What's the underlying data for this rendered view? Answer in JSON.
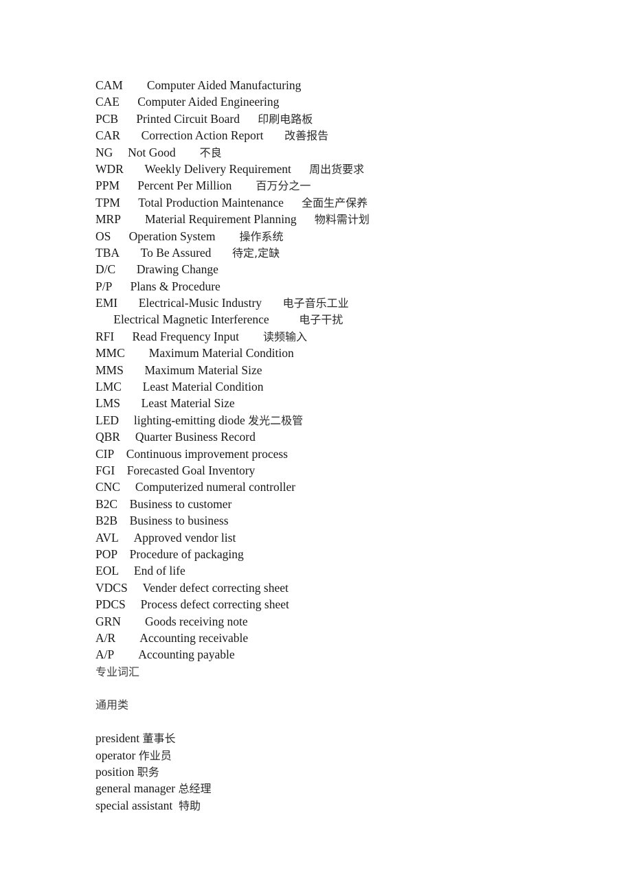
{
  "document": {
    "type": "bilingual-abbreviation-glossary",
    "page_background": "#ffffff",
    "text_color": "#181818",
    "abbreviation_entries": [
      {
        "abbr": "CAM",
        "gap1": "        ",
        "definition": "Computer Aided Manufacturing",
        "gap2": "",
        "chinese": ""
      },
      {
        "abbr": "CAE",
        "gap1": "      ",
        "definition": "Computer Aided Engineering",
        "gap2": "",
        "chinese": ""
      },
      {
        "abbr": "PCB",
        "gap1": "      ",
        "definition": "Printed Circuit Board",
        "gap2": "      ",
        "chinese": "印刷电路板"
      },
      {
        "abbr": "CAR",
        "gap1": "       ",
        "definition": "Correction Action Report",
        "gap2": "       ",
        "chinese": "改善报告"
      },
      {
        "abbr": "NG",
        "gap1": "     ",
        "definition": "Not Good",
        "gap2": "        ",
        "chinese": "不良"
      },
      {
        "abbr": "WDR",
        "gap1": "       ",
        "definition": "Weekly Delivery Requirement",
        "gap2": "      ",
        "chinese": "周出货要求"
      },
      {
        "abbr": "PPM",
        "gap1": "      ",
        "definition": "Percent Per Million",
        "gap2": "        ",
        "chinese": "百万分之一"
      },
      {
        "abbr": "TPM",
        "gap1": "      ",
        "definition": "Total Production Maintenance",
        "gap2": "      ",
        "chinese": "全面生产保养"
      },
      {
        "abbr": "MRP",
        "gap1": "        ",
        "definition": "Material Requirement Planning",
        "gap2": "      ",
        "chinese": "物料需计划"
      },
      {
        "abbr": "OS",
        "gap1": "      ",
        "definition": "Operation System",
        "gap2": "        ",
        "chinese": "操作系统"
      },
      {
        "abbr": "TBA",
        "gap1": "       ",
        "definition": "To Be Assured",
        "gap2": "       ",
        "chinese": "待定,定缺"
      },
      {
        "abbr": "D/C",
        "gap1": "       ",
        "definition": "Drawing Change",
        "gap2": "",
        "chinese": ""
      },
      {
        "abbr": "P/P",
        "gap1": "      ",
        "definition": "Plans & Procedure",
        "gap2": "",
        "chinese": ""
      },
      {
        "abbr": "EMI",
        "gap1": "       ",
        "definition": "Electrical-Music Industry",
        "gap2": "       ",
        "chinese": "电子音乐工业"
      },
      {
        "abbr": "",
        "gap1": "      ",
        "definition": "Electrical Magnetic Interference",
        "gap2": "          ",
        "chinese": "电子干扰"
      },
      {
        "abbr": "RFI",
        "gap1": "      ",
        "definition": "Read Frequency Input",
        "gap2": "        ",
        "chinese": "读频输入"
      },
      {
        "abbr": "MMC",
        "gap1": "        ",
        "definition": "Maximum Material Condition",
        "gap2": "",
        "chinese": ""
      },
      {
        "abbr": "MMS",
        "gap1": "       ",
        "definition": "Maximum Material Size",
        "gap2": "",
        "chinese": ""
      },
      {
        "abbr": "LMC",
        "gap1": "       ",
        "definition": "Least Material Condition",
        "gap2": "",
        "chinese": ""
      },
      {
        "abbr": "LMS",
        "gap1": "       ",
        "definition": "Least Material Size",
        "gap2": "",
        "chinese": ""
      },
      {
        "abbr": "LED",
        "gap1": "     ",
        "definition": "lighting-emitting diode",
        "gap2": " ",
        "chinese": "发光二极管"
      },
      {
        "abbr": "QBR",
        "gap1": "     ",
        "definition": "Quarter Business Record",
        "gap2": "",
        "chinese": ""
      },
      {
        "abbr": "CIP",
        "gap1": "    ",
        "definition": "Continuous improvement process",
        "gap2": "",
        "chinese": ""
      },
      {
        "abbr": "FGI",
        "gap1": "    ",
        "definition": "Forecasted Goal Inventory",
        "gap2": "",
        "chinese": ""
      },
      {
        "abbr": "CNC",
        "gap1": "     ",
        "definition": "Computerized numeral controller",
        "gap2": "",
        "chinese": ""
      },
      {
        "abbr": "B2C",
        "gap1": "    ",
        "definition": "Business to customer",
        "gap2": "",
        "chinese": ""
      },
      {
        "abbr": "B2B",
        "gap1": "    ",
        "definition": "Business to business",
        "gap2": "",
        "chinese": ""
      },
      {
        "abbr": "AVL",
        "gap1": "     ",
        "definition": "Approved vendor list",
        "gap2": "",
        "chinese": ""
      },
      {
        "abbr": "POP",
        "gap1": "    ",
        "definition": "Procedure of packaging",
        "gap2": "",
        "chinese": ""
      },
      {
        "abbr": "EOL",
        "gap1": "     ",
        "definition": "End of life",
        "gap2": "",
        "chinese": ""
      },
      {
        "abbr": "VDCS",
        "gap1": "     ",
        "definition": "Vender defect correcting sheet",
        "gap2": "",
        "chinese": ""
      },
      {
        "abbr": "PDCS",
        "gap1": "     ",
        "definition": "Process defect correcting sheet",
        "gap2": "",
        "chinese": ""
      },
      {
        "abbr": "GRN",
        "gap1": "        ",
        "definition": "Goods receiving note",
        "gap2": "",
        "chinese": ""
      },
      {
        "abbr": "A/R",
        "gap1": "        ",
        "definition": "Accounting receivable",
        "gap2": "",
        "chinese": ""
      },
      {
        "abbr": "A/P",
        "gap1": "        ",
        "definition": "Accounting payable",
        "gap2": "",
        "chinese": ""
      }
    ],
    "section_heading_1": "专业词汇",
    "section_heading_2": "通用类",
    "term_entries": [
      {
        "english": "president",
        "separator": " ",
        "chinese": "董事长"
      },
      {
        "english": "operator",
        "separator": " ",
        "chinese": "作业员"
      },
      {
        "english": "position",
        "separator": " ",
        "chinese": "职务"
      },
      {
        "english": "general manager",
        "separator": " ",
        "chinese": "总经理"
      },
      {
        "english": "special assistant",
        "separator": "  ",
        "chinese": "特助"
      }
    ]
  }
}
